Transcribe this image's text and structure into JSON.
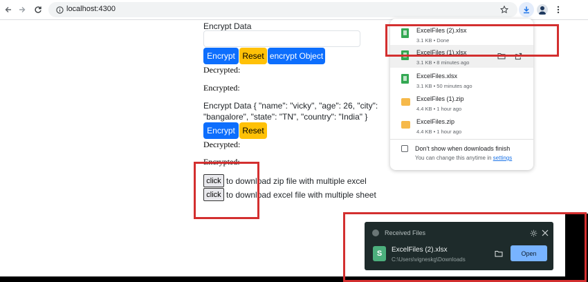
{
  "browser": {
    "url": "localhost:4300",
    "icons": {
      "back": "arrow-left-icon",
      "forward": "arrow-right-icon",
      "reload": "reload-icon",
      "site_info": "info-icon",
      "bookmark": "star-icon",
      "downloads": "download-icon",
      "profile": "profile-icon",
      "menu": "kebab-menu-icon"
    }
  },
  "page": {
    "section1": {
      "heading": "Encrypt Data",
      "input_value": "",
      "encrypt_label": "Encrypt",
      "reset_label": "Reset",
      "encrypt_object_label": "encrypt Object",
      "decrypted_label": "Decrypted:",
      "encrypted_label": "Encrypted:"
    },
    "section2": {
      "heading_line1": "Encrypt Data { \"name\": \"vicky\", \"age\": 26, \"city\":",
      "heading_line2": "\"bangalore\", \"state\": \"TN\", \"country\": \"India\" }",
      "encrypt_label": "Encrypt",
      "reset_label": "Reset",
      "decrypted_label": "Decrypted:",
      "encrypted_label": "Encrypted:"
    },
    "downloads": [
      {
        "button_label": "click",
        "text": "to download zip file with multiple excel"
      },
      {
        "button_label": "click",
        "text": "to download excel file with multiple sheet"
      }
    ]
  },
  "downloads_panel": {
    "items": [
      {
        "name": "ExcelFiles (2).xlsx",
        "meta": "3.1 KB • Done",
        "type": "xlsx"
      },
      {
        "name": "ExcelFiles (1).xlsx",
        "meta": "3.1 KB • 8 minutes ago",
        "type": "xlsx"
      },
      {
        "name": "ExcelFiles.xlsx",
        "meta": "3.1 KB • 50 minutes ago",
        "type": "xlsx"
      },
      {
        "name": "ExcelFiles (1).zip",
        "meta": "4.4 KB • 1 hour ago",
        "type": "zip"
      },
      {
        "name": "ExcelFiles.zip",
        "meta": "4.4 KB • 1 hour ago",
        "type": "zip"
      }
    ],
    "checkbox_label": "Don't show when downloads finish",
    "hint_prefix": "You can change this anytime in ",
    "hint_link": "settings"
  },
  "toast": {
    "title": "Received Files",
    "file_name": "ExcelFiles (2).xlsx",
    "file_path": "C:\\Users\\vigneskg\\Downloads",
    "file_icon_letter": "S",
    "open_label": "Open"
  },
  "colors": {
    "primary_button": "#0d6efd",
    "warning_button": "#ffc107",
    "highlight_box": "#d32f2f",
    "toast_background": "#1e2b2b",
    "toast_open_button": "#78b3ff"
  }
}
